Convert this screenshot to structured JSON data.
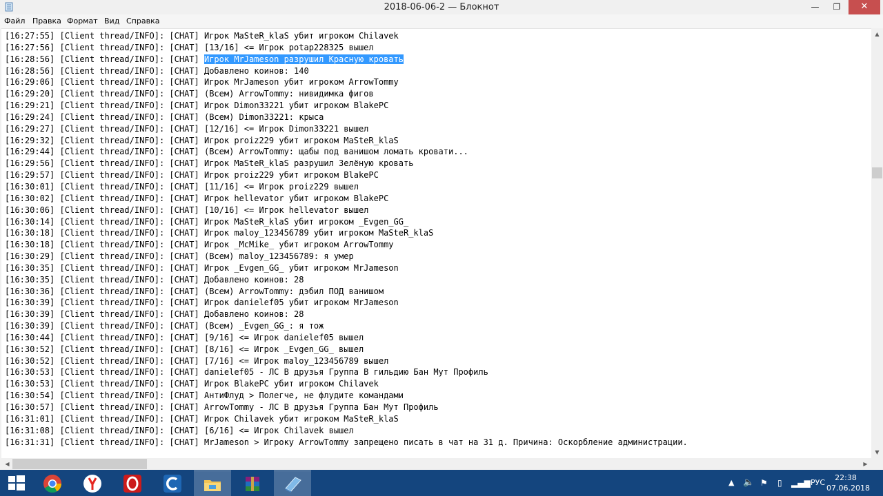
{
  "window": {
    "title": "2018-06-06-2 — Блокнот",
    "minimize": "—",
    "maximize": "❐",
    "close": "✕"
  },
  "menu": {
    "items": [
      "Файл",
      "Правка",
      "Формат",
      "Вид",
      "Справка"
    ]
  },
  "editor": {
    "selected_line_index": 2,
    "lines": [
      {
        "prefix": "[16:27:55] [Client thread/INFO]: [CHAT] ",
        "text": "Игрок MaSteR_klaS убит игроком Chilavek"
      },
      {
        "prefix": "[16:27:56] [Client thread/INFO]: [CHAT] ",
        "text": "[13/16] <= Игрок potap228325 вышел"
      },
      {
        "prefix": "[16:28:56] [Client thread/INFO]: [CHAT] ",
        "text": "Игрок MrJameson разрушил Красную кровать"
      },
      {
        "prefix": "[16:28:56] [Client thread/INFO]: [CHAT] ",
        "text": "Добавлено коинов: 140"
      },
      {
        "prefix": "[16:29:06] [Client thread/INFO]: [CHAT] ",
        "text": "Игрок MrJameson убит игроком ArrowTommy"
      },
      {
        "prefix": "[16:29:20] [Client thread/INFO]: [CHAT] ",
        "text": "(Всем) ArrowTommy: нивидимка фигов"
      },
      {
        "prefix": "[16:29:21] [Client thread/INFO]: [CHAT] ",
        "text": "Игрок Dimon33221 убит игроком BlakePC"
      },
      {
        "prefix": "[16:29:24] [Client thread/INFO]: [CHAT] ",
        "text": "(Всем) Dimon33221: крыса"
      },
      {
        "prefix": "[16:29:27] [Client thread/INFO]: [CHAT] ",
        "text": "[12/16] <= Игрок Dimon33221 вышел"
      },
      {
        "prefix": "[16:29:32] [Client thread/INFO]: [CHAT] ",
        "text": "Игрок proiz229 убит игроком MaSteR_klaS"
      },
      {
        "prefix": "[16:29:44] [Client thread/INFO]: [CHAT] ",
        "text": "(Всем) ArrowTommy: щабы под ванишом ломать кровати..."
      },
      {
        "prefix": "[16:29:56] [Client thread/INFO]: [CHAT] ",
        "text": "Игрок MaSteR_klaS разрушил Зелёную кровать"
      },
      {
        "prefix": "[16:29:57] [Client thread/INFO]: [CHAT] ",
        "text": "Игрок proiz229 убит игроком BlakePC"
      },
      {
        "prefix": "[16:30:01] [Client thread/INFO]: [CHAT] ",
        "text": "[11/16] <= Игрок proiz229 вышел"
      },
      {
        "prefix": "[16:30:02] [Client thread/INFO]: [CHAT] ",
        "text": "Игрок hellevator убит игроком BlakePC"
      },
      {
        "prefix": "[16:30:06] [Client thread/INFO]: [CHAT] ",
        "text": "[10/16] <= Игрок hellevator вышел"
      },
      {
        "prefix": "[16:30:14] [Client thread/INFO]: [CHAT] ",
        "text": "Игрок MaSteR_klaS убит игроком _Evgen_GG_"
      },
      {
        "prefix": "[16:30:18] [Client thread/INFO]: [CHAT] ",
        "text": "Игрок maloy_123456789 убит игроком MaSteR_klaS"
      },
      {
        "prefix": "[16:30:18] [Client thread/INFO]: [CHAT] ",
        "text": "Игрок _McMike_ убит игроком ArrowTommy"
      },
      {
        "prefix": "[16:30:29] [Client thread/INFO]: [CHAT] ",
        "text": "(Всем) maloy_123456789: я умер"
      },
      {
        "prefix": "[16:30:35] [Client thread/INFO]: [CHAT] ",
        "text": "Игрок _Evgen_GG_ убит игроком MrJameson"
      },
      {
        "prefix": "[16:30:35] [Client thread/INFO]: [CHAT] ",
        "text": "Добавлено коинов: 28"
      },
      {
        "prefix": "[16:30:36] [Client thread/INFO]: [CHAT] ",
        "text": "(Всем) ArrowTommy: дэбил ПОД ванишом"
      },
      {
        "prefix": "[16:30:39] [Client thread/INFO]: [CHAT] ",
        "text": "Игрок danielef05 убит игроком MrJameson"
      },
      {
        "prefix": "[16:30:39] [Client thread/INFO]: [CHAT] ",
        "text": "Добавлено коинов: 28"
      },
      {
        "prefix": "[16:30:39] [Client thread/INFO]: [CHAT] ",
        "text": "(Всем) _Evgen_GG_: я тож"
      },
      {
        "prefix": "[16:30:44] [Client thread/INFO]: [CHAT] ",
        "text": "[9/16] <= Игрок danielef05 вышел"
      },
      {
        "prefix": "[16:30:52] [Client thread/INFO]: [CHAT] ",
        "text": "[8/16] <= Игрок _Evgen_GG_ вышел"
      },
      {
        "prefix": "[16:30:52] [Client thread/INFO]: [CHAT] ",
        "text": "[7/16] <= Игрок maloy_123456789 вышел"
      },
      {
        "prefix": "[16:30:53] [Client thread/INFO]: [CHAT] ",
        "text": "danielef05 - ЛС В друзья Группа В гильдию Бан Мут Профиль"
      },
      {
        "prefix": "[16:30:53] [Client thread/INFO]: [CHAT] ",
        "text": "Игрок BlakePC убит игроком Chilavek"
      },
      {
        "prefix": "[16:30:54] [Client thread/INFO]: [CHAT] ",
        "text": "АнтиФлуд > Полегче, не флудите командами"
      },
      {
        "prefix": "[16:30:57] [Client thread/INFO]: [CHAT] ",
        "text": "ArrowTommy - ЛС В друзья Группа Бан Мут Профиль"
      },
      {
        "prefix": "[16:31:01] [Client thread/INFO]: [CHAT] ",
        "text": "Игрок Chilavek убит игроком MaSteR_klaS"
      },
      {
        "prefix": "[16:31:08] [Client thread/INFO]: [CHAT] ",
        "text": "[6/16] <= Игрок Chilavek вышел"
      },
      {
        "prefix": "[16:31:31] [Client thread/INFO]: [CHAT] ",
        "text": "MrJameson > Игроку ArrowTommy запрещено писать в чат на 31 д. Причина: Оскорбление администрации."
      }
    ]
  },
  "scrollbars": {
    "vertical_position": 0.3,
    "horizontal_position": 0.0
  },
  "taskbar": {
    "apps": [
      "windows-start",
      "chrome",
      "yandex-browser",
      "opera",
      "ccleaner",
      "file-explorer",
      "winrar",
      "notepad"
    ],
    "active_app": "notepad",
    "tray": {
      "language": "РУС",
      "time": "22:38",
      "date": "07.06.2018"
    }
  },
  "colors": {
    "selection": "#3399ff",
    "taskbar": "#14457e",
    "close_button": "#c74f4f"
  }
}
